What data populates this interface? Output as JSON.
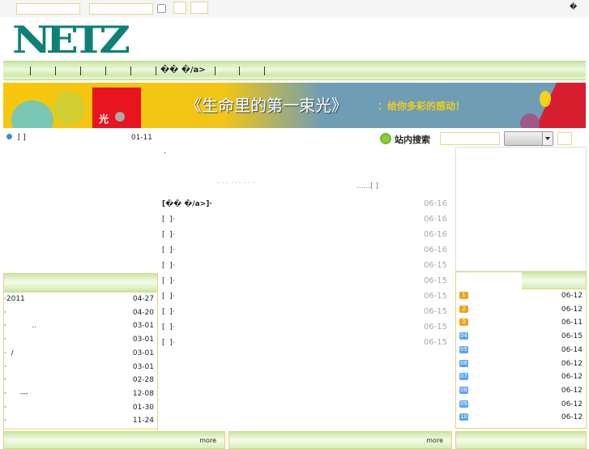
{
  "topbar": {
    "right_glyph": "�"
  },
  "logo": {
    "text": "NETZ"
  },
  "nav": {
    "item_label": "�� �/a>"
  },
  "banner": {
    "title": "《生命里的第一束光》",
    "subtitle": "：给你多彩的感动！",
    "book_char": "光"
  },
  "left_top": {
    "item": "[ ]",
    "date": "01-11"
  },
  "middle": {
    "dot": ".",
    "summary": "·  · ·  · · ·  · ·  ·",
    "more": "......[ ]",
    "items": [
      {
        "label": "[�� �/a>]·",
        "date": "06-16"
      },
      {
        "label": "[  ]·",
        "date": "06-16"
      },
      {
        "label": "[  ]·",
        "date": "06-16"
      },
      {
        "label": "[  ]·",
        "date": "06-16"
      },
      {
        "label": "[  ]·",
        "date": "06-15"
      },
      {
        "label": "[  ]·",
        "date": "06-15"
      },
      {
        "label": "[  ]·",
        "date": "06-15"
      },
      {
        "label": "[  ]·",
        "date": "06-15"
      },
      {
        "label": "[  ]·",
        "date": "06-15"
      },
      {
        "label": "[  ]·",
        "date": "06-15"
      }
    ]
  },
  "search": {
    "label": "站内搜索",
    "icon": "clover-icon"
  },
  "left_list": [
    {
      "label": "·2011",
      "date": "04-27"
    },
    {
      "label": "·",
      "date": "04-20"
    },
    {
      "label": "·           ..",
      "date": "03-01"
    },
    {
      "label": "·",
      "date": "03-01"
    },
    {
      "label": "·  /",
      "date": "03-01"
    },
    {
      "label": "·",
      "date": "03-01"
    },
    {
      "label": "·",
      "date": "02-28"
    },
    {
      "label": "·      ---",
      "date": "12-08"
    },
    {
      "label": "·",
      "date": "01-30"
    },
    {
      "label": "·",
      "date": "11-24"
    }
  ],
  "ranking": [
    {
      "rank": "1",
      "date": "06-12"
    },
    {
      "rank": "2",
      "date": "06-12"
    },
    {
      "rank": "3",
      "date": "06-11"
    },
    {
      "rank": "04",
      "date": "06-15"
    },
    {
      "rank": "05",
      "date": "06-14"
    },
    {
      "rank": "06",
      "date": "06-12"
    },
    {
      "rank": "07",
      "date": "06-12"
    },
    {
      "rank": "08",
      "date": "06-12"
    },
    {
      "rank": "09",
      "date": "06-12"
    },
    {
      "rank": "10",
      "date": "06-12"
    }
  ],
  "bottom": {
    "more1": "more",
    "more2": "more"
  },
  "colors": {
    "accent_green": "#c9e7a3",
    "logo": "#0f8078",
    "top_rank": "#f0a417",
    "rank": "#5aa4f0"
  }
}
